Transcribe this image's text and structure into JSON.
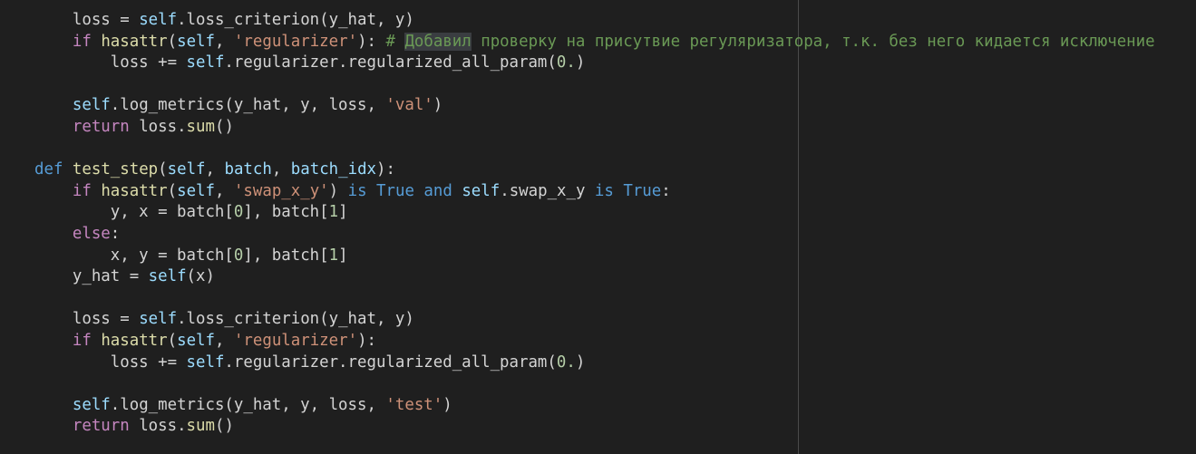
{
  "editor": {
    "lines": [
      {
        "indent": "    ",
        "tokens": [
          {
            "t": "loss = ",
            "c": "plain"
          },
          {
            "t": "self",
            "c": "self"
          },
          {
            "t": ".loss_criterion(y_hat, y)",
            "c": "plain"
          }
        ]
      },
      {
        "indent": "    ",
        "tokens": [
          {
            "t": "if",
            "c": "kw"
          },
          {
            "t": " ",
            "c": "plain"
          },
          {
            "t": "hasattr",
            "c": "fn"
          },
          {
            "t": "(",
            "c": "plain"
          },
          {
            "t": "self",
            "c": "self"
          },
          {
            "t": ", ",
            "c": "plain"
          },
          {
            "t": "'regularizer'",
            "c": "str"
          },
          {
            "t": "): ",
            "c": "plain"
          },
          {
            "t": "# ",
            "c": "cmt"
          },
          {
            "t": "Добавил",
            "c": "cmt",
            "hl": true
          },
          {
            "t": " проверку на присутвие регуляризатора, т.к. без него кидается исключение",
            "c": "cmt"
          }
        ]
      },
      {
        "indent": "        ",
        "tokens": [
          {
            "t": "loss += ",
            "c": "plain"
          },
          {
            "t": "self",
            "c": "self"
          },
          {
            "t": ".regularizer.regularized_all_param(",
            "c": "plain"
          },
          {
            "t": "0.",
            "c": "num"
          },
          {
            "t": ")",
            "c": "plain"
          }
        ]
      },
      {
        "indent": "",
        "tokens": []
      },
      {
        "indent": "    ",
        "tokens": [
          {
            "t": "self",
            "c": "self"
          },
          {
            "t": ".log_metrics(y_hat, y, loss, ",
            "c": "plain"
          },
          {
            "t": "'val'",
            "c": "str"
          },
          {
            "t": ")",
            "c": "plain"
          }
        ]
      },
      {
        "indent": "    ",
        "tokens": [
          {
            "t": "return",
            "c": "kw"
          },
          {
            "t": " loss.",
            "c": "plain"
          },
          {
            "t": "sum",
            "c": "fn"
          },
          {
            "t": "()",
            "c": "plain"
          }
        ]
      },
      {
        "indent": "",
        "tokens": []
      },
      {
        "indent": "",
        "tokens": [
          {
            "t": "def",
            "c": "def"
          },
          {
            "t": " ",
            "c": "plain"
          },
          {
            "t": "test_step",
            "c": "fn"
          },
          {
            "t": "(",
            "c": "plain"
          },
          {
            "t": "self",
            "c": "self"
          },
          {
            "t": ", ",
            "c": "plain"
          },
          {
            "t": "batch",
            "c": "param"
          },
          {
            "t": ", ",
            "c": "plain"
          },
          {
            "t": "batch_idx",
            "c": "param"
          },
          {
            "t": "):",
            "c": "plain"
          }
        ]
      },
      {
        "indent": "    ",
        "tokens": [
          {
            "t": "if",
            "c": "kw"
          },
          {
            "t": " ",
            "c": "plain"
          },
          {
            "t": "hasattr",
            "c": "fn"
          },
          {
            "t": "(",
            "c": "plain"
          },
          {
            "t": "self",
            "c": "self"
          },
          {
            "t": ", ",
            "c": "plain"
          },
          {
            "t": "'swap_x_y'",
            "c": "str"
          },
          {
            "t": ") ",
            "c": "plain"
          },
          {
            "t": "is",
            "c": "const"
          },
          {
            "t": " ",
            "c": "plain"
          },
          {
            "t": "True",
            "c": "const"
          },
          {
            "t": " ",
            "c": "plain"
          },
          {
            "t": "and",
            "c": "const"
          },
          {
            "t": " ",
            "c": "plain"
          },
          {
            "t": "self",
            "c": "self"
          },
          {
            "t": ".swap_x_y ",
            "c": "plain"
          },
          {
            "t": "is",
            "c": "const"
          },
          {
            "t": " ",
            "c": "plain"
          },
          {
            "t": "True",
            "c": "const"
          },
          {
            "t": ":",
            "c": "plain"
          }
        ]
      },
      {
        "indent": "        ",
        "tokens": [
          {
            "t": "y, x = batch[",
            "c": "plain"
          },
          {
            "t": "0",
            "c": "num"
          },
          {
            "t": "], batch[",
            "c": "plain"
          },
          {
            "t": "1",
            "c": "num"
          },
          {
            "t": "]",
            "c": "plain"
          }
        ]
      },
      {
        "indent": "    ",
        "tokens": [
          {
            "t": "else",
            "c": "kw"
          },
          {
            "t": ":",
            "c": "plain"
          }
        ]
      },
      {
        "indent": "        ",
        "tokens": [
          {
            "t": "x, y = batch[",
            "c": "plain"
          },
          {
            "t": "0",
            "c": "num"
          },
          {
            "t": "], batch[",
            "c": "plain"
          },
          {
            "t": "1",
            "c": "num"
          },
          {
            "t": "]",
            "c": "plain"
          }
        ]
      },
      {
        "indent": "    ",
        "tokens": [
          {
            "t": "y_hat = ",
            "c": "plain"
          },
          {
            "t": "self",
            "c": "self"
          },
          {
            "t": "(x)",
            "c": "plain"
          }
        ]
      },
      {
        "indent": "",
        "tokens": []
      },
      {
        "indent": "    ",
        "tokens": [
          {
            "t": "loss = ",
            "c": "plain"
          },
          {
            "t": "self",
            "c": "self"
          },
          {
            "t": ".loss_criterion(y_hat, y)",
            "c": "plain"
          }
        ]
      },
      {
        "indent": "    ",
        "tokens": [
          {
            "t": "if",
            "c": "kw"
          },
          {
            "t": " ",
            "c": "plain"
          },
          {
            "t": "hasattr",
            "c": "fn"
          },
          {
            "t": "(",
            "c": "plain"
          },
          {
            "t": "self",
            "c": "self"
          },
          {
            "t": ", ",
            "c": "plain"
          },
          {
            "t": "'regularizer'",
            "c": "str"
          },
          {
            "t": "):",
            "c": "plain"
          }
        ]
      },
      {
        "indent": "        ",
        "tokens": [
          {
            "t": "loss += ",
            "c": "plain"
          },
          {
            "t": "self",
            "c": "self"
          },
          {
            "t": ".regularizer.regularized_all_param(",
            "c": "plain"
          },
          {
            "t": "0.",
            "c": "num"
          },
          {
            "t": ")",
            "c": "plain"
          }
        ]
      },
      {
        "indent": "",
        "tokens": []
      },
      {
        "indent": "    ",
        "tokens": [
          {
            "t": "self",
            "c": "self"
          },
          {
            "t": ".log_metrics(y_hat, y, loss, ",
            "c": "plain"
          },
          {
            "t": "'test'",
            "c": "str"
          },
          {
            "t": ")",
            "c": "plain"
          }
        ]
      },
      {
        "indent": "    ",
        "tokens": [
          {
            "t": "return",
            "c": "kw"
          },
          {
            "t": " loss.",
            "c": "plain"
          },
          {
            "t": "sum",
            "c": "fn"
          },
          {
            "t": "()",
            "c": "plain"
          }
        ]
      }
    ]
  },
  "colors": {
    "background": "#1f1f1f",
    "keyword": "#c586c0",
    "def": "#569cd6",
    "function": "#dcdcaa",
    "self": "#9cdcfe",
    "string": "#ce9178",
    "number": "#b5cea8",
    "comment": "#6a9955",
    "text": "#d4d4d4"
  }
}
